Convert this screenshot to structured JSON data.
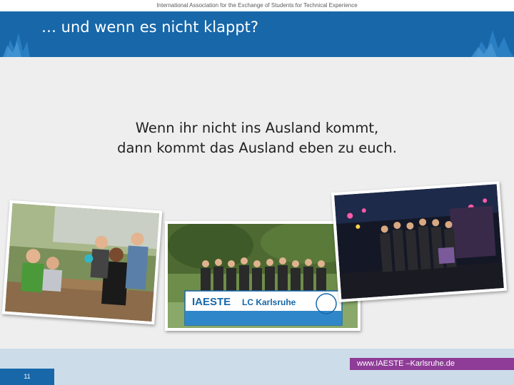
{
  "header": {
    "tagline": "International Association for the Exchange of Students for Technical Experience",
    "title": "… und wenn es nicht klappt?"
  },
  "body": {
    "line1": "Wenn ihr nicht ins Ausland kommt,",
    "line2": "dann kommt das Ausland eben zu euch."
  },
  "photos": {
    "banner_text": "IAESTE",
    "banner_sub": "LC Karlsruhe"
  },
  "footer": {
    "page_number": "11",
    "url": "www.IAESTE –Karlsruhe.de"
  },
  "colors": {
    "header_blue": "#1767a9",
    "footer_light": "#ccdde9",
    "url_purple": "#8e3c97"
  }
}
